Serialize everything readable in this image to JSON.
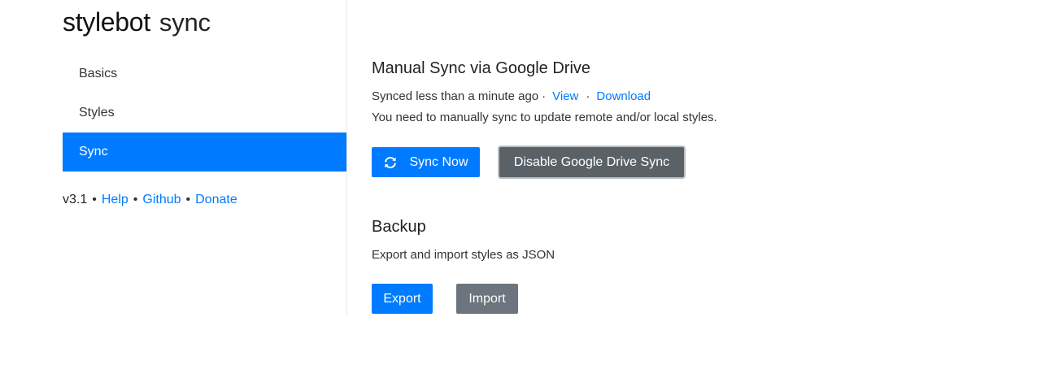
{
  "brand": {
    "name": "stylebot",
    "page": "sync"
  },
  "sidebar": {
    "items": [
      {
        "label": "Basics",
        "active": false
      },
      {
        "label": "Styles",
        "active": false
      },
      {
        "label": "Sync",
        "active": true
      }
    ],
    "footer": {
      "version": "v3.1",
      "separator": "•",
      "help": "Help",
      "github": "Github",
      "donate": "Donate"
    }
  },
  "sync_section": {
    "title": "Manual Sync via Google Drive",
    "status": "Synced less than a minute ago",
    "separator": "·",
    "view_link": "View",
    "download_link": "Download",
    "note": "You need to manually sync to update remote and/or local styles.",
    "sync_now_label": "Sync Now",
    "disable_label": "Disable Google Drive Sync",
    "sync_icon": "refresh-icon"
  },
  "backup_section": {
    "title": "Backup",
    "description": "Export and import styles as JSON",
    "export_label": "Export",
    "import_label": "Import"
  },
  "colors": {
    "primary": "#007bff",
    "secondary": "#6c757d",
    "dark": "#5a6268"
  }
}
